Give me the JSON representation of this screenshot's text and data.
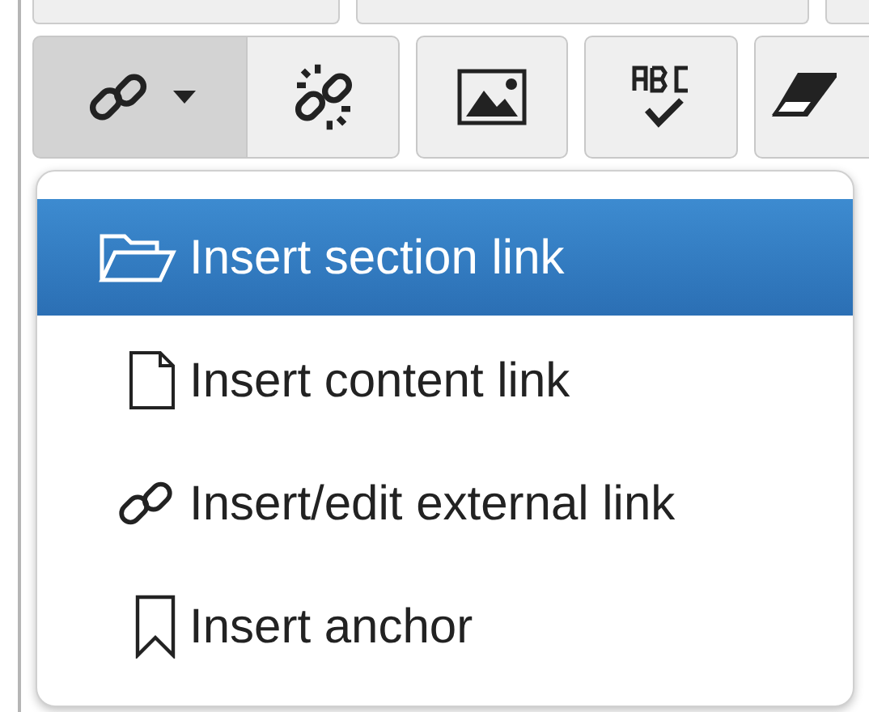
{
  "toolbar": [
    {
      "kind": "link",
      "pressed": true
    },
    {
      "kind": "unlink",
      "pressed": false
    },
    {
      "kind": "image",
      "pressed": false
    },
    {
      "kind": "spellcheck",
      "pressed": false
    },
    {
      "kind": "eraser",
      "pressed": false
    }
  ],
  "menu": [
    {
      "kind": "folder",
      "label": "Insert section link",
      "selected": true
    },
    {
      "kind": "document",
      "label": "Insert content link",
      "selected": false
    },
    {
      "kind": "link",
      "label": "Insert/edit external link",
      "selected": false
    },
    {
      "kind": "bookmark",
      "label": "Insert anchor",
      "selected": false
    }
  ]
}
